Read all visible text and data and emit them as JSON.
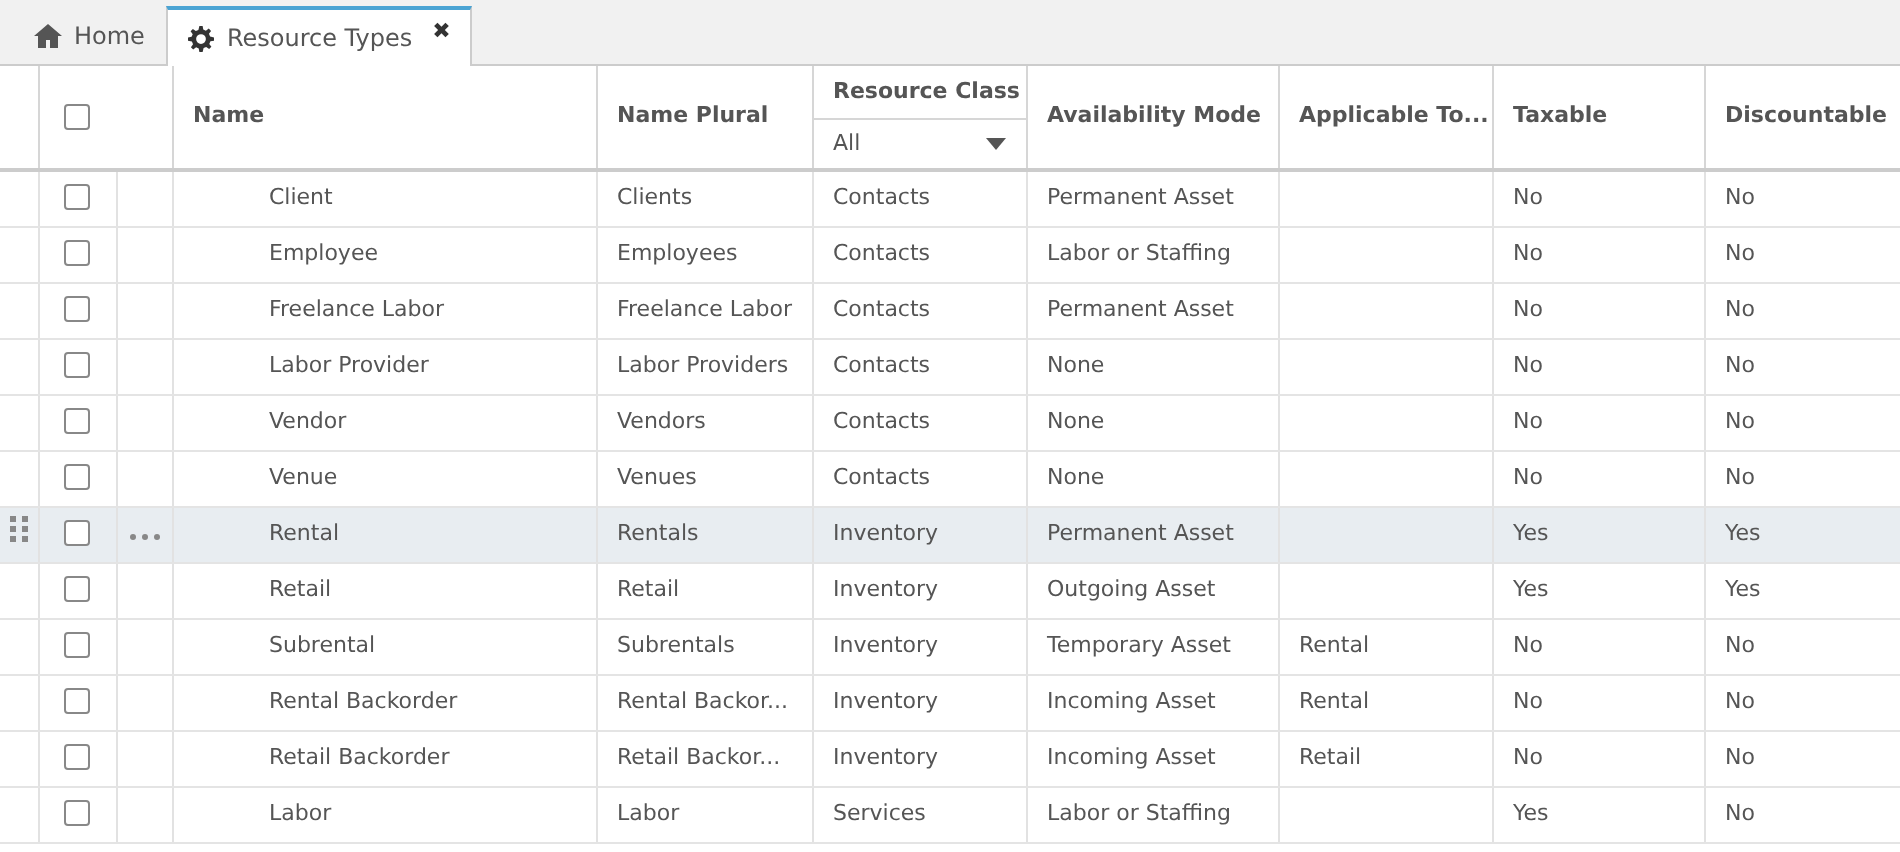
{
  "tabs": [
    {
      "label": "Home",
      "kind": "home",
      "selected": false
    },
    {
      "label": "Resource Types",
      "kind": "settings",
      "selected": true,
      "close": "✖"
    }
  ],
  "table": {
    "select_all_checked": false,
    "columns": [
      "Name",
      "Name Plural",
      "Resource Class",
      "Availability Mode",
      "Applicable To...",
      "Taxable",
      "Discountable"
    ],
    "filter": {
      "value": "All"
    },
    "rows": [
      {
        "checked": false,
        "highlighted": false,
        "cells": [
          "Client",
          "Clients",
          "Contacts",
          "Permanent Asset",
          "",
          "No",
          "No"
        ]
      },
      {
        "checked": false,
        "highlighted": false,
        "cells": [
          "Employee",
          "Employees",
          "Contacts",
          "Labor or Staffing",
          "",
          "No",
          "No"
        ]
      },
      {
        "checked": false,
        "highlighted": false,
        "cells": [
          "Freelance Labor",
          "Freelance Labor",
          "Contacts",
          "Permanent Asset",
          "",
          "No",
          "No"
        ]
      },
      {
        "checked": false,
        "highlighted": false,
        "cells": [
          "Labor Provider",
          "Labor Providers",
          "Contacts",
          "None",
          "",
          "No",
          "No"
        ]
      },
      {
        "checked": false,
        "highlighted": false,
        "cells": [
          "Vendor",
          "Vendors",
          "Contacts",
          "None",
          "",
          "No",
          "No"
        ]
      },
      {
        "checked": false,
        "highlighted": false,
        "cells": [
          "Venue",
          "Venues",
          "Contacts",
          "None",
          "",
          "No",
          "No"
        ]
      },
      {
        "checked": false,
        "highlighted": true,
        "cells": [
          "Rental",
          "Rentals",
          "Inventory",
          "Permanent Asset",
          "",
          "Yes",
          "Yes"
        ]
      },
      {
        "checked": false,
        "highlighted": false,
        "cells": [
          "Retail",
          "Retail",
          "Inventory",
          "Outgoing Asset",
          "",
          "Yes",
          "Yes"
        ]
      },
      {
        "checked": false,
        "highlighted": false,
        "cells": [
          "Subrental",
          "Subrentals",
          "Inventory",
          "Temporary Asset",
          "Rental",
          "No",
          "No"
        ]
      },
      {
        "checked": false,
        "highlighted": false,
        "cells": [
          "Rental Backorder",
          "Rental Backor...",
          "Inventory",
          "Incoming Asset",
          "Rental",
          "No",
          "No"
        ]
      },
      {
        "checked": false,
        "highlighted": false,
        "cells": [
          "Retail Backorder",
          "Retail Backor...",
          "Inventory",
          "Incoming Asset",
          "Retail",
          "No",
          "No"
        ]
      },
      {
        "checked": false,
        "highlighted": false,
        "cells": [
          "Labor",
          "Labor",
          "Services",
          "Labor or Staffing",
          "",
          "Yes",
          "No"
        ]
      }
    ]
  }
}
